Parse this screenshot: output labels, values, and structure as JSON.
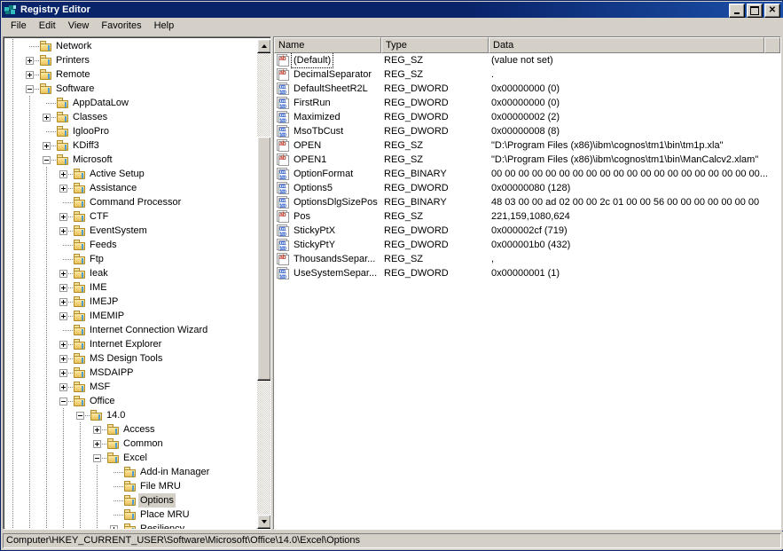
{
  "window": {
    "title": "Registry Editor",
    "icon": "registry-editor-icon",
    "buttons": {
      "minimize": "_",
      "maximize": "□",
      "close": "✕"
    }
  },
  "menu": {
    "items": [
      {
        "label": "File"
      },
      {
        "label": "Edit"
      },
      {
        "label": "View"
      },
      {
        "label": "Favorites"
      },
      {
        "label": "Help"
      }
    ]
  },
  "tree": {
    "selected": "Options",
    "rows": [
      {
        "label": "Network",
        "depth": 2,
        "expander": "none"
      },
      {
        "label": "Printers",
        "depth": 2,
        "expander": "plus"
      },
      {
        "label": "Remote",
        "depth": 2,
        "expander": "plus"
      },
      {
        "label": "Software",
        "depth": 2,
        "expander": "minus"
      },
      {
        "label": "AppDataLow",
        "depth": 3,
        "expander": "none"
      },
      {
        "label": "Classes",
        "depth": 3,
        "expander": "plus"
      },
      {
        "label": "IglooPro",
        "depth": 3,
        "expander": "none"
      },
      {
        "label": "KDiff3",
        "depth": 3,
        "expander": "plus"
      },
      {
        "label": "Microsoft",
        "depth": 3,
        "expander": "minus"
      },
      {
        "label": "Active Setup",
        "depth": 4,
        "expander": "plus"
      },
      {
        "label": "Assistance",
        "depth": 4,
        "expander": "plus"
      },
      {
        "label": "Command Processor",
        "depth": 4,
        "expander": "none"
      },
      {
        "label": "CTF",
        "depth": 4,
        "expander": "plus"
      },
      {
        "label": "EventSystem",
        "depth": 4,
        "expander": "plus"
      },
      {
        "label": "Feeds",
        "depth": 4,
        "expander": "none"
      },
      {
        "label": "Ftp",
        "depth": 4,
        "expander": "none"
      },
      {
        "label": "Ieak",
        "depth": 4,
        "expander": "plus"
      },
      {
        "label": "IME",
        "depth": 4,
        "expander": "plus"
      },
      {
        "label": "IMEJP",
        "depth": 4,
        "expander": "plus"
      },
      {
        "label": "IMEMIP",
        "depth": 4,
        "expander": "plus"
      },
      {
        "label": "Internet Connection Wizard",
        "depth": 4,
        "expander": "none"
      },
      {
        "label": "Internet Explorer",
        "depth": 4,
        "expander": "plus"
      },
      {
        "label": "MS Design Tools",
        "depth": 4,
        "expander": "plus"
      },
      {
        "label": "MSDAIPP",
        "depth": 4,
        "expander": "plus"
      },
      {
        "label": "MSF",
        "depth": 4,
        "expander": "plus"
      },
      {
        "label": "Office",
        "depth": 4,
        "expander": "minus"
      },
      {
        "label": "14.0",
        "depth": 5,
        "expander": "minus"
      },
      {
        "label": "Access",
        "depth": 6,
        "expander": "plus"
      },
      {
        "label": "Common",
        "depth": 6,
        "expander": "plus"
      },
      {
        "label": "Excel",
        "depth": 6,
        "expander": "minus"
      },
      {
        "label": "Add-in Manager",
        "depth": 7,
        "expander": "none"
      },
      {
        "label": "File MRU",
        "depth": 7,
        "expander": "none"
      },
      {
        "label": "Options",
        "depth": 7,
        "expander": "none"
      },
      {
        "label": "Place MRU",
        "depth": 7,
        "expander": "none"
      },
      {
        "label": "Resiliency",
        "depth": 7,
        "expander": "plus"
      }
    ]
  },
  "list": {
    "columns": [
      {
        "label": "Name"
      },
      {
        "label": "Type"
      },
      {
        "label": "Data"
      },
      {
        "label": ""
      }
    ],
    "rows": [
      {
        "name": "(Default)",
        "type": "REG_SZ",
        "data": "(value not set)",
        "icon": "string-value-icon",
        "focused": true
      },
      {
        "name": "DecimalSeparator",
        "type": "REG_SZ",
        "data": ".",
        "icon": "string-value-icon"
      },
      {
        "name": "DefaultSheetR2L",
        "type": "REG_DWORD",
        "data": "0x00000000 (0)",
        "icon": "binary-value-icon"
      },
      {
        "name": "FirstRun",
        "type": "REG_DWORD",
        "data": "0x00000000 (0)",
        "icon": "binary-value-icon"
      },
      {
        "name": "Maximized",
        "type": "REG_DWORD",
        "data": "0x00000002 (2)",
        "icon": "binary-value-icon"
      },
      {
        "name": "MsoTbCust",
        "type": "REG_DWORD",
        "data": "0x00000008 (8)",
        "icon": "binary-value-icon"
      },
      {
        "name": "OPEN",
        "type": "REG_SZ",
        "data": "\"D:\\Program Files (x86)\\ibm\\cognos\\tm1\\bin\\tm1p.xla\"",
        "icon": "string-value-icon"
      },
      {
        "name": "OPEN1",
        "type": "REG_SZ",
        "data": "\"D:\\Program Files (x86)\\ibm\\cognos\\tm1\\bin\\ManCalcv2.xlam\"",
        "icon": "string-value-icon"
      },
      {
        "name": "OptionFormat",
        "type": "REG_BINARY",
        "data": "00 00 00 00 00 00 00 00 00 00 00 00 00 00 00 00 00 00 00 00...",
        "icon": "binary-value-icon"
      },
      {
        "name": "Options5",
        "type": "REG_DWORD",
        "data": "0x00000080 (128)",
        "icon": "binary-value-icon"
      },
      {
        "name": "OptionsDlgSizePos",
        "type": "REG_BINARY",
        "data": "48 03 00 00 ad 02 00 00 2c 01 00 00 56 00 00 00 00 00 00 00",
        "icon": "binary-value-icon"
      },
      {
        "name": "Pos",
        "type": "REG_SZ",
        "data": "221,159,1080,624",
        "icon": "string-value-icon"
      },
      {
        "name": "StickyPtX",
        "type": "REG_DWORD",
        "data": "0x000002cf (719)",
        "icon": "binary-value-icon"
      },
      {
        "name": "StickyPtY",
        "type": "REG_DWORD",
        "data": "0x000001b0 (432)",
        "icon": "binary-value-icon"
      },
      {
        "name": "ThousandsSepar...",
        "type": "REG_SZ",
        "data": ",",
        "icon": "string-value-icon"
      },
      {
        "name": "UseSystemSepar...",
        "type": "REG_DWORD",
        "data": "0x00000001 (1)",
        "icon": "binary-value-icon"
      }
    ],
    "icon_labels": {
      "string": "ab",
      "binary": "011\n100"
    }
  },
  "statusbar": {
    "path": "Computer\\HKEY_CURRENT_USER\\Software\\Microsoft\\Office\\14.0\\Excel\\Options"
  },
  "colors": {
    "title_start": "#0a246a",
    "title_end": "#1b4fa8",
    "chrome": "#d4d0c8",
    "selection": "#d4d0c8",
    "string_icon": "#c0392b",
    "binary_icon": "#2255cc",
    "folder": "#f5d680"
  }
}
